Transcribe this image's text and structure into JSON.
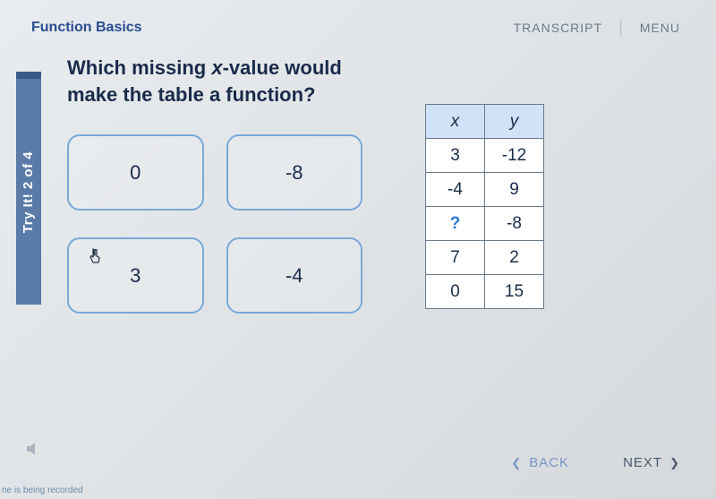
{
  "header": {
    "title": "Function Basics",
    "transcript": "TRANSCRIPT",
    "menu": "MENU"
  },
  "sidebar": {
    "label": "Try It! 2 of 4"
  },
  "question": {
    "line1_pre": "Which missing ",
    "line1_var": "x",
    "line1_post": "-value would",
    "line2": "make the table a function?"
  },
  "options": [
    "0",
    "-8",
    "3",
    "-4"
  ],
  "table": {
    "headers": [
      "x",
      "y"
    ],
    "rows": [
      [
        "3",
        "-12"
      ],
      [
        "-4",
        "9"
      ],
      [
        "?",
        "-8"
      ],
      [
        "7",
        "2"
      ],
      [
        "0",
        "15"
      ]
    ]
  },
  "nav": {
    "back": "BACK",
    "next": "NEXT"
  },
  "footer": {
    "recording": "ne is being recorded"
  }
}
